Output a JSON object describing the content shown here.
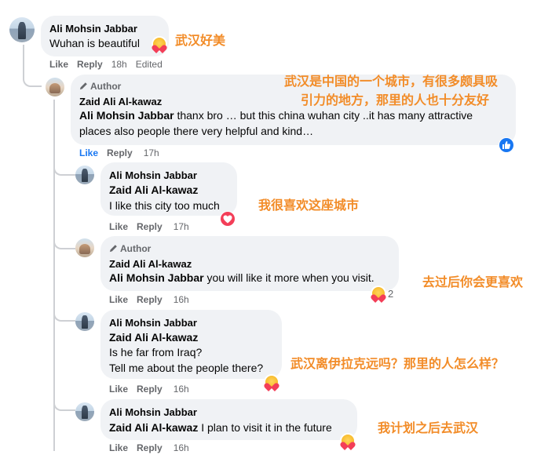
{
  "actions": {
    "like": "Like",
    "reply": "Reply",
    "edited": "Edited"
  },
  "author_badge": "Author",
  "comments": [
    {
      "name": "Ali Mohsin Jabbar",
      "text": "Wuhan is beautiful",
      "time": "18h",
      "translation": "武汉好美"
    },
    {
      "name": "Zaid Ali Al-kawaz",
      "mention": "Ali Mohsin Jabbar",
      "text": " thanx bro … but this china wuhan city ..it has many attractive places also people there very helpful and kind…",
      "time": "17h",
      "translation_line1": "武汉是中国的一个城市，有很多颇具吸",
      "translation_line2": "引力的地方，那里的人也十分友好"
    },
    {
      "name": "Ali Mohsin Jabbar",
      "mention": "Zaid Ali Al-kawaz",
      "text": "I like this city too much",
      "time": "17h",
      "translation": "我很喜欢这座城市"
    },
    {
      "name": "Zaid Ali Al-kawaz",
      "mention": "Ali Mohsin Jabbar",
      "text": " you will like it more when you visit.",
      "time": "16h",
      "reaction_count": "2",
      "translation": "去过后你会更喜欢"
    },
    {
      "name": "Ali Mohsin Jabbar",
      "mention": "Zaid Ali Al-kawaz",
      "text_line1": "Is he far from Iraq?",
      "text_line2": "Tell me about the people there?",
      "time": "16h",
      "translation": "武汉离伊拉克远吗？那里的人怎么样？"
    },
    {
      "name": "Ali Mohsin Jabbar",
      "mention": "Zaid Ali Al-kawaz",
      "text": " I plan to visit it in the future",
      "time": "16h",
      "translation": "我计划之后去武汉"
    }
  ]
}
